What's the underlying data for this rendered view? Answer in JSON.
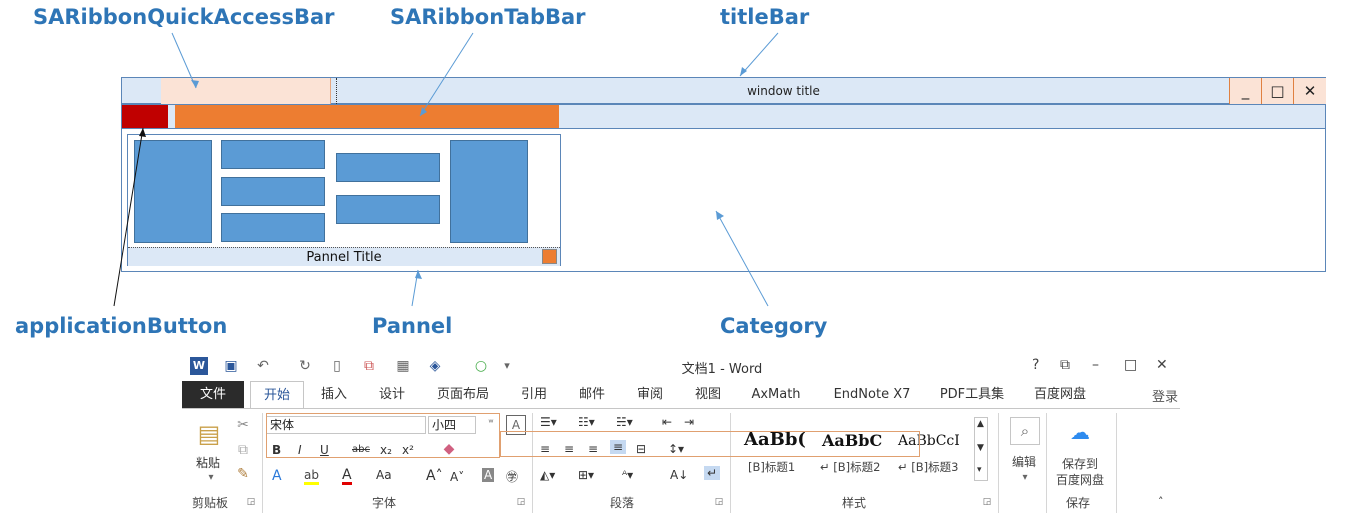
{
  "labels": {
    "quick_access_bar": "SARibbonQuickAccessBar",
    "tab_bar": "SARibbonTabBar",
    "title_bar": "titleBar",
    "application_button": "applicationButton",
    "pannel": "Pannel",
    "category": "Category"
  },
  "schematic": {
    "window_title": "window title",
    "min_btn": "_",
    "max_btn": "□",
    "close_btn": "✕",
    "pannel_title": "Pannel Title"
  },
  "word": {
    "title": "文档1 - Word",
    "help": "?",
    "restore": "⧉",
    "minimize": "–",
    "maximize": "□",
    "close": "✕",
    "login": "登录",
    "tabs": [
      "文件",
      "开始",
      "插入",
      "设计",
      "页面布局",
      "引用",
      "邮件",
      "审阅",
      "视图",
      "AxMath",
      "EndNote X7",
      "PDF工具集",
      "百度网盘"
    ],
    "font_name": "宋体",
    "font_size": "小四",
    "paste": "粘贴",
    "groups": {
      "clipboard": "剪贴板",
      "font": "字体",
      "paragraph": "段落",
      "styles": "样式",
      "save": "保存"
    },
    "styles": [
      {
        "preview": "AaBb(",
        "name": "[B]标题1"
      },
      {
        "preview": "AaBbC",
        "name": "↵ [B]标题2"
      },
      {
        "preview": "AaBbCcI",
        "name": "↵ [B]标题3"
      }
    ],
    "edit": "编辑",
    "save_to": "保存到",
    "baidu_disk": "百度网盘"
  }
}
